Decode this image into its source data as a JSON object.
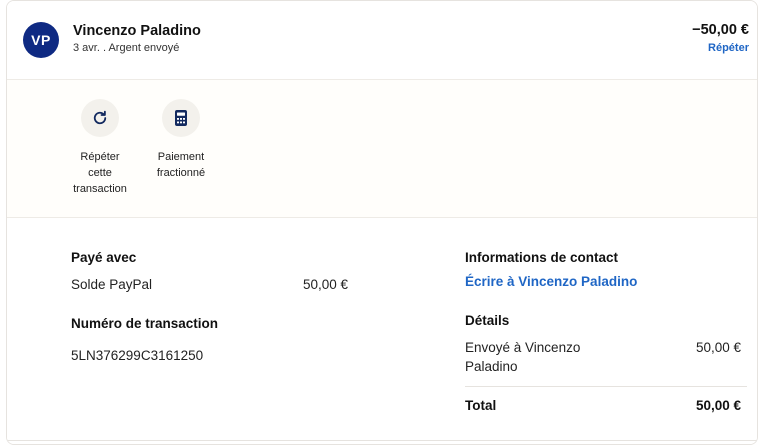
{
  "header": {
    "avatar_initials": "VP",
    "name": "Vincenzo Paladino",
    "subtitle": "3 avr. . Argent envoyé",
    "amount": "−50,00 €",
    "repeat_link": "Répéter"
  },
  "actions": [
    {
      "icon": "refresh-icon",
      "label": "Répéter cette transaction",
      "lines": [
        "Répéter",
        "cette",
        "transaction"
      ]
    },
    {
      "icon": "calculator-icon",
      "label": "Paiement fractionné",
      "lines": [
        "Paiement",
        "fractionné"
      ]
    }
  ],
  "payment": {
    "heading": "Payé avec",
    "method": "Solde PayPal",
    "amount": "50,00 €"
  },
  "transaction": {
    "heading": "Numéro de transaction",
    "id": "5LN376299C3161250"
  },
  "contact": {
    "heading": "Informations de contact",
    "link": "Écrire à Vincenzo Paladino"
  },
  "summary": {
    "heading": "Détails",
    "sent_line1": "Envoyé à Vincenzo",
    "sent_line2": "Paladino",
    "sent_amount": "50,00 €",
    "total_label": "Total",
    "total_amount": "50,00 €"
  },
  "colors": {
    "avatar_bg": "#0f2a83",
    "link": "#1f66c5",
    "icon": "#12295f"
  }
}
